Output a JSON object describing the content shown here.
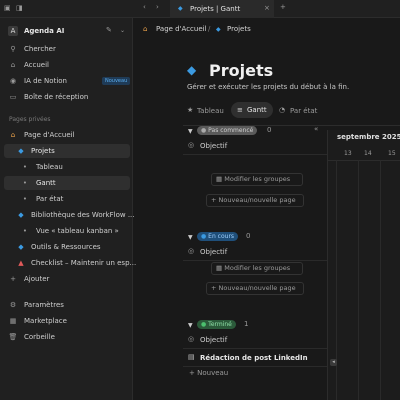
{
  "tab": {
    "title": "Projets | Gantt"
  },
  "breadcrumb": {
    "home": "Page d'Accueil",
    "current": "Projets"
  },
  "sidebar": {
    "workspace": "Agenda AI",
    "items": [
      {
        "label": "Chercher",
        "icon": "search-icon"
      },
      {
        "label": "Accueil",
        "icon": "home-icon"
      },
      {
        "label": "IA de Notion",
        "icon": "ai-icon",
        "badge": "Nouveau"
      },
      {
        "label": "Boîte de réception",
        "icon": "inbox-icon"
      }
    ],
    "section": "Pages privées",
    "tree": [
      {
        "label": "Page d'Accueil"
      },
      {
        "label": "Projets"
      },
      {
        "label": "Tableau"
      },
      {
        "label": "Gantt"
      },
      {
        "label": "Par état"
      },
      {
        "label": "Bibliothèque des WorkFlow ..."
      },
      {
        "label": "Vue « tableau kanban »"
      },
      {
        "label": "Outils & Ressources"
      },
      {
        "label": "Checklist – Maintenir un esp..."
      },
      {
        "label": "Ajouter"
      }
    ],
    "footer": [
      {
        "label": "Paramètres"
      },
      {
        "label": "Marketplace"
      },
      {
        "label": "Corbeille"
      }
    ]
  },
  "page": {
    "title": "Projets",
    "description": "Gérer et exécuter les projets du début à la fin.",
    "views": [
      "Tableau",
      "Gantt",
      "Par état"
    ]
  },
  "groups": [
    {
      "status": "Pas commencé",
      "count": "0",
      "color": "#5a5a5a",
      "text_color": "#d0d0d0",
      "rows": [
        "Objectif"
      ],
      "action1": "Modifier les groupes",
      "action2": "Nouveau/nouvelle page"
    },
    {
      "status": "En cours",
      "count": "0",
      "color": "#1f4f7a",
      "text_color": "#9fd0ff",
      "rows": [
        "Objectif"
      ],
      "action1": "Modifier les groupes",
      "action2": "Nouveau/nouvelle page"
    },
    {
      "status": "Terminé",
      "count": "1",
      "color": "#2b5a3a",
      "text_color": "#8fe0a8",
      "rows": [
        "Objectif",
        "Rédaction de post LinkedIn"
      ],
      "action2": "Nouveau"
    }
  ],
  "timeline": {
    "month": "septembre 2025",
    "days": [
      "13",
      "14",
      "15"
    ]
  }
}
